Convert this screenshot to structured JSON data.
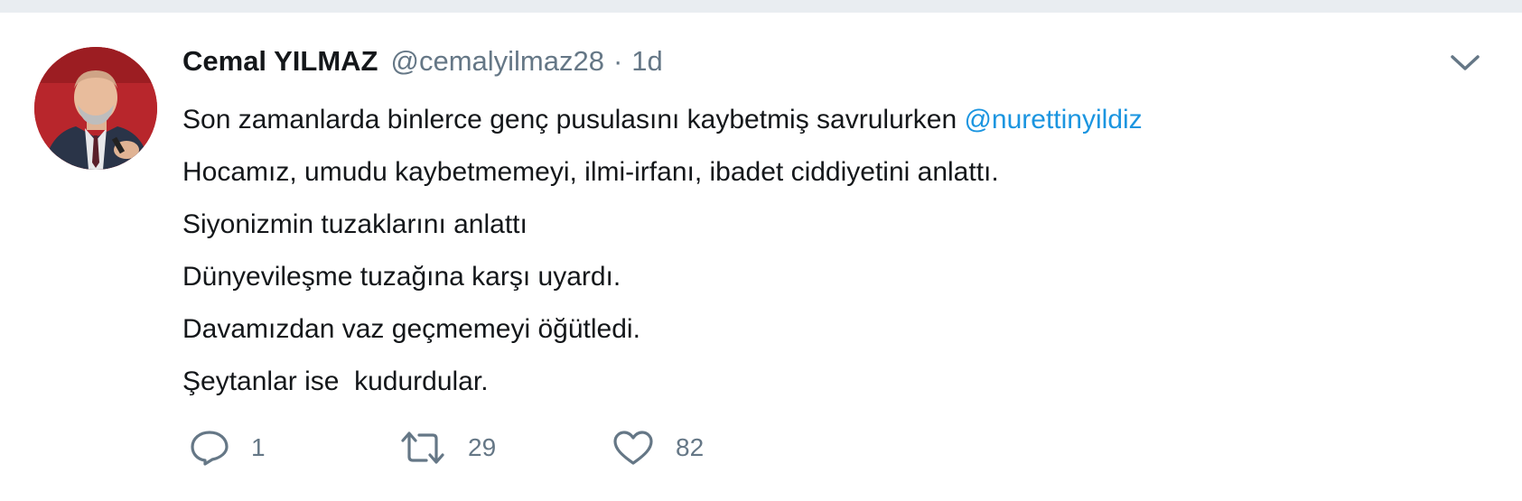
{
  "tweet": {
    "author_name": "Cemal YILMAZ",
    "handle": "@cemalyilmaz28",
    "separator": "·",
    "time": "1d",
    "lines": [
      {
        "text": "Son zamanlarda binlerce genç pusulasını kaybetmiş savrulurken ",
        "mention": "@nurettinyildiz"
      },
      {
        "text": "Hocamız, umudu kaybetmemeyi, ilmi-irfanı, ibadet ciddiyetini anlattı."
      },
      {
        "text": "Siyonizmin tuzaklarını anlattı"
      },
      {
        "text": "Dünyevileşme tuzağına karşı uyardı."
      },
      {
        "text": "Davamızdan vaz geçmemeyi öğütledi."
      },
      {
        "text": "Şeytanlar ise  kudurdular."
      }
    ],
    "actions": {
      "reply": {
        "icon": "reply-icon",
        "count": "1"
      },
      "retweet": {
        "icon": "retweet-icon",
        "count": "29"
      },
      "like": {
        "icon": "heart-icon",
        "count": "82"
      }
    }
  },
  "colors": {
    "text": "#14171a",
    "muted": "#657786",
    "link": "#1b95e0",
    "background": "#ffffff"
  }
}
